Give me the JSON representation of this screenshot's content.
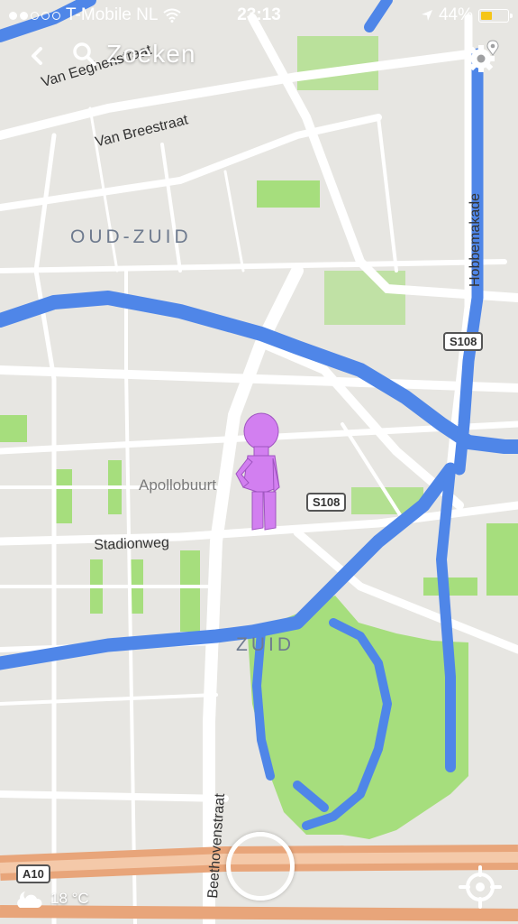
{
  "status_bar": {
    "carrier": "T-Mobile NL",
    "signal_filled": 2,
    "signal_total": 5,
    "time": "23:13",
    "battery_text": "44%",
    "battery_level": 0.44
  },
  "toolbar": {
    "back_icon": "chevron-left-icon",
    "search_label": "Zoeken",
    "settings_icon": "gear-location-icon"
  },
  "map": {
    "districts": [
      "OUD-ZUID",
      "ZUID"
    ],
    "streets": [
      "Van Eeghenstraat",
      "Van Breestraat",
      "Hobbemakade",
      "Stadionweg",
      "Beethovenstraat"
    ],
    "neighbourhoods": [
      "Apollobuurt"
    ],
    "road_shields": [
      "S108",
      "S108",
      "A10"
    ]
  },
  "weather": {
    "icon": "partly-cloudy-night-icon",
    "temperature": "18 °C"
  },
  "controls": {
    "camera_button": "camera-button",
    "locate_icon": "crosshair-icon"
  },
  "colors": {
    "water": "#4f86e8",
    "park": "#a6de7d",
    "land": "#e7e6e2",
    "road": "#ffffff",
    "highway": "#e8a57a",
    "avatar": "#d27ff0"
  }
}
